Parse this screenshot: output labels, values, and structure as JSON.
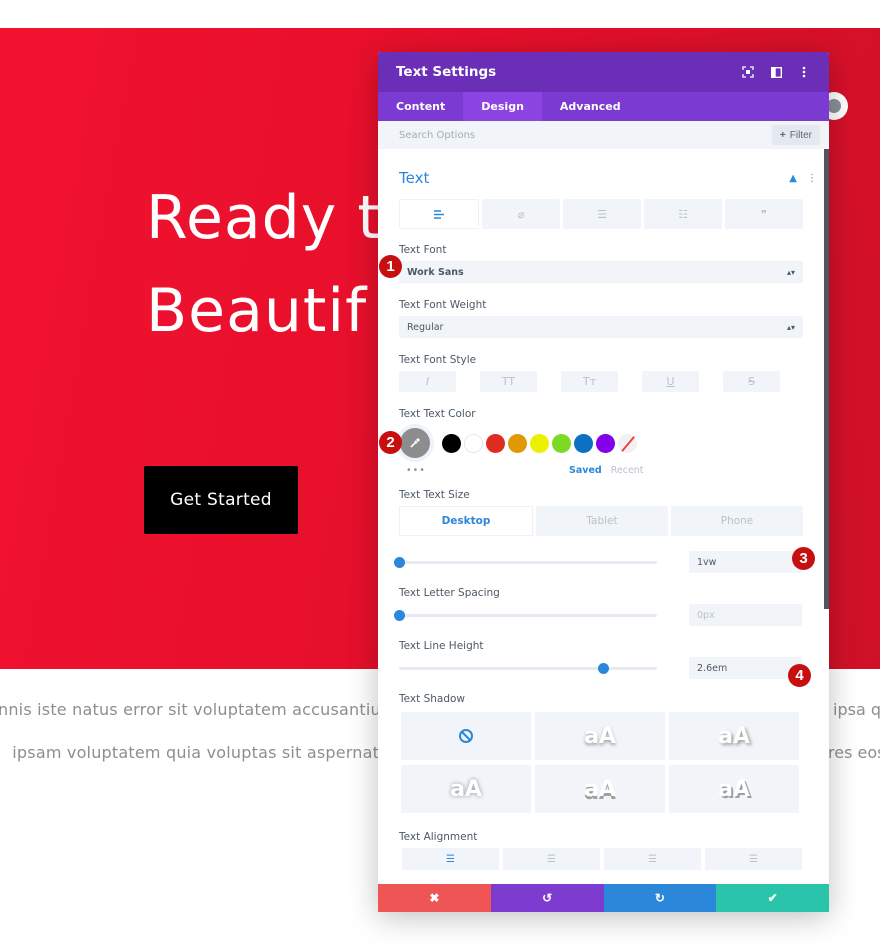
{
  "page": {
    "hero_title": "Ready t\nBeautif",
    "cta_label": "Get Started",
    "body_lines": [
      "nnis iste natus error sit voluptatem accusantiu",
      " ipsam voluptatem quia voluptas sit aspernatu"
    ],
    "body_lines_right": [
      "ipsa q",
      "res eos"
    ],
    "hero_gradient": [
      "#f21230",
      "#cf1128"
    ]
  },
  "modal": {
    "title": "Text Settings",
    "header_icons": [
      "focus-icon",
      "split-view-icon",
      "more-vertical-icon"
    ],
    "tabs": [
      {
        "label": "Content",
        "active": false
      },
      {
        "label": "Design",
        "active": true
      },
      {
        "label": "Advanced",
        "active": false
      }
    ],
    "search_placeholder": "Search Options",
    "filter_label": "Filter",
    "section": {
      "title": "Text",
      "text_type_tabs": [
        "align-left-icon",
        "link-icon",
        "unordered-list-icon",
        "ordered-list-icon",
        "quote-icon"
      ],
      "active_text_type": 0
    },
    "fields": {
      "font": {
        "label": "Text Font",
        "value": "Work Sans"
      },
      "weight": {
        "label": "Text Font Weight",
        "value": "Regular"
      },
      "style": {
        "label": "Text Font Style",
        "buttons": [
          "I",
          "TT",
          "Tт",
          "U",
          "S"
        ]
      },
      "color": {
        "label": "Text Text Color",
        "swatches": [
          "#000000",
          "#ffffff",
          "#e02b20",
          "#e09900",
          "#edf000",
          "#7cda24",
          "#0c71c3",
          "#8300e9"
        ],
        "saved_label": "Saved",
        "recent_label": "Recent"
      },
      "size": {
        "label": "Text Text Size",
        "devices": [
          "Desktop",
          "Tablet",
          "Phone"
        ],
        "active_device": "Desktop",
        "value": "1vw",
        "slider_fraction": 0.0
      },
      "letter_spacing": {
        "label": "Text Letter Spacing",
        "placeholder": "0px",
        "slider_fraction": 0.0
      },
      "line_height": {
        "label": "Text Line Height",
        "value": "2.6em",
        "slider_fraction": 0.79
      },
      "shadow": {
        "label": "Text Shadow",
        "sample": "aA"
      },
      "alignment": {
        "label": "Text Alignment",
        "options": [
          "left",
          "center",
          "right",
          "justify"
        ],
        "active": "left"
      }
    },
    "footer": {
      "cancel_icon": "✖",
      "undo_icon": "↺",
      "redo_icon": "↻",
      "save_icon": "✔"
    }
  },
  "callouts": [
    "1",
    "2",
    "3",
    "4"
  ]
}
